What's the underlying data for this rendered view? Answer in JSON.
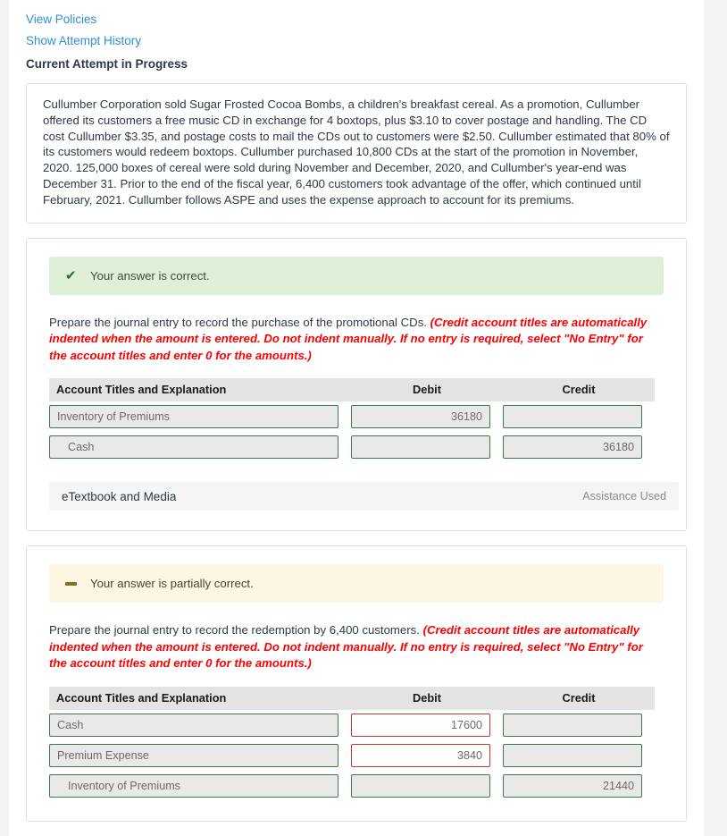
{
  "top_links": {
    "view_policies": "View Policies",
    "show_attempt_history": "Show Attempt History",
    "attempt_heading": "Current Attempt in Progress"
  },
  "problem": {
    "text": "Cullumber Corporation sold Sugar Frosted Cocoa Bombs, a children's breakfast cereal. As a promotion, Cullumber offered its customers a free music CD in exchange for 4 boxtops, plus $3.10 to cover postage and handling. The CD cost Cullumber $3.35, and postage costs to mail the CDs out to customers were $2.50. Cullumber estimated that 80% of its customers would redeem boxtops. Cullumber purchased 10,800 CDs at the start of the promotion in November, 2020. 125,000 boxes of cereal were sold during November and December, 2020, and Cullumber's year-end was December 31. Prior to the end of the fiscal year, 6,400 customers took advantage of the offer, which continued until February, 2021. Cullumber follows ASPE and uses the expense approach to account for its premiums."
  },
  "table_headers": {
    "account": "Account Titles and Explanation",
    "debit": "Debit",
    "credit": "Credit"
  },
  "sections": [
    {
      "status": "correct",
      "status_icon": "check-icon",
      "status_text": "Your answer is correct.",
      "prompt_plain": "Prepare the journal entry to record the purchase of the promotional CDs. ",
      "prompt_hint": "(Credit account titles are automatically indented when the amount is entered. Do not indent manually. If no entry is required, select \"No Entry\" for the account titles and enter 0 for the amounts.)",
      "rows": [
        {
          "account": "Inventory of Premiums",
          "indent": false,
          "account_state": "ok",
          "debit": "36180",
          "debit_state": "ok",
          "credit": "",
          "credit_state": "ok"
        },
        {
          "account": "Cash",
          "indent": true,
          "account_state": "ok",
          "debit": "",
          "debit_state": "ok",
          "credit": "36180",
          "credit_state": "ok"
        }
      ],
      "etextbook_label": "eTextbook and Media",
      "etextbook_status": "Assistance Used"
    },
    {
      "status": "partial",
      "status_icon": "dash-icon",
      "status_text": "Your answer is partially correct.",
      "prompt_plain": "Prepare the journal entry to record the redemption by 6,400 customers. ",
      "prompt_hint": "(Credit account titles are automatically indented when the amount is entered. Do not indent manually. If no entry is required, select \"No Entry\" for the account titles and enter 0 for the amounts.)",
      "rows": [
        {
          "account": "Cash",
          "indent": false,
          "account_state": "ok",
          "debit": "17600",
          "debit_state": "wrong",
          "credit": "",
          "credit_state": "ok"
        },
        {
          "account": "Premium Expense",
          "indent": false,
          "account_state": "ok",
          "debit": "3840",
          "debit_state": "wrong",
          "credit": "",
          "credit_state": "ok"
        },
        {
          "account": "Inventory of Premiums",
          "indent": true,
          "account_state": "ok",
          "debit": "",
          "debit_state": "ok",
          "credit": "21440",
          "credit_state": "ok"
        }
      ]
    }
  ],
  "colors": {
    "link": "#2d8fd5",
    "correct_bg": "#dff0d8",
    "partial_bg": "#fcf6e3",
    "hint_red": "#ff0000",
    "field_ok_border": "#3a7d44",
    "field_wrong_border": "#c0392b",
    "header_bg": "#e4e4e4"
  }
}
